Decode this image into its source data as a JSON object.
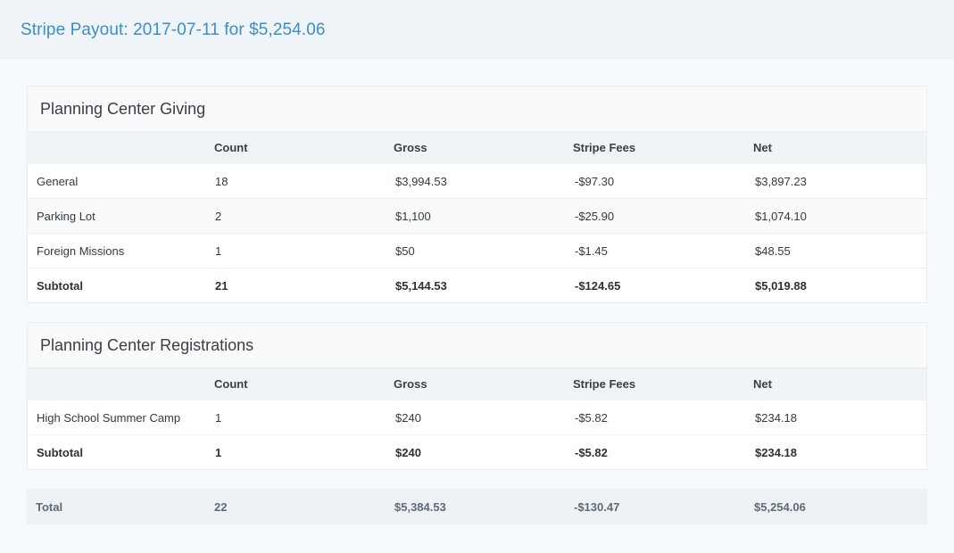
{
  "header": {
    "title": "Stripe Payout: 2017-07-11 for $5,254.06"
  },
  "columns": [
    "",
    "Count",
    "Gross",
    "Stripe Fees",
    "Net"
  ],
  "sections": [
    {
      "title": "Planning Center Giving",
      "rows": [
        {
          "name": "General",
          "count": "18",
          "gross": "$3,994.53",
          "fees": "-$97.30",
          "net": "$3,897.23"
        },
        {
          "name": "Parking Lot",
          "count": "2",
          "gross": "$1,100",
          "fees": "-$25.90",
          "net": "$1,074.10"
        },
        {
          "name": "Foreign Missions",
          "count": "1",
          "gross": "$50",
          "fees": "-$1.45",
          "net": "$48.55"
        }
      ],
      "subtotal": {
        "name": "Subtotal",
        "count": "21",
        "gross": "$5,144.53",
        "fees": "-$124.65",
        "net": "$5,019.88"
      }
    },
    {
      "title": "Planning Center Registrations",
      "rows": [
        {
          "name": "High School Summer Camp",
          "count": "1",
          "gross": "$240",
          "fees": "-$5.82",
          "net": "$234.18"
        }
      ],
      "subtotal": {
        "name": "Subtotal",
        "count": "1",
        "gross": "$240",
        "fees": "-$5.82",
        "net": "$234.18"
      }
    }
  ],
  "total": {
    "name": "Total",
    "count": "22",
    "gross": "$5,384.53",
    "fees": "-$130.47",
    "net": "$5,254.06"
  }
}
